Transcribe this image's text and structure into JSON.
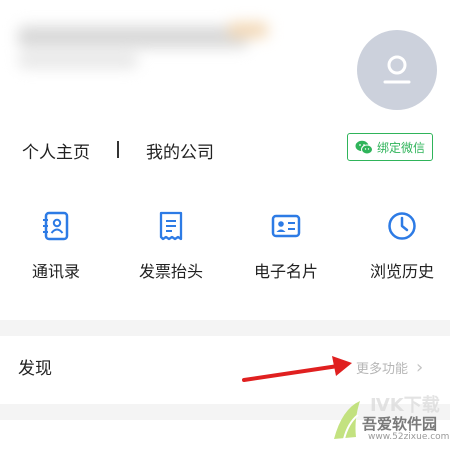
{
  "profile": {
    "links": {
      "homepage": "个人主页",
      "separator": "|",
      "my_company": "我的公司"
    },
    "bind_wechat_label": "绑定微信",
    "avatar_icon": "user-placeholder-icon"
  },
  "shortcuts": [
    {
      "label": "通讯录",
      "icon": "contacts-icon"
    },
    {
      "label": "发票抬头",
      "icon": "invoice-icon"
    },
    {
      "label": "电子名片",
      "icon": "business-card-icon"
    },
    {
      "label": "浏览历史",
      "icon": "clock-icon"
    }
  ],
  "discover": {
    "title": "发现",
    "more_label": "更多功能",
    "more_chevron": "›"
  },
  "watermark": {
    "text": "吾爱软件园",
    "url": "www.52zixue.com"
  },
  "colors": {
    "accent_blue": "#2d7be5",
    "wechat_green": "#2fb45a",
    "annotation_red": "#e02020"
  }
}
